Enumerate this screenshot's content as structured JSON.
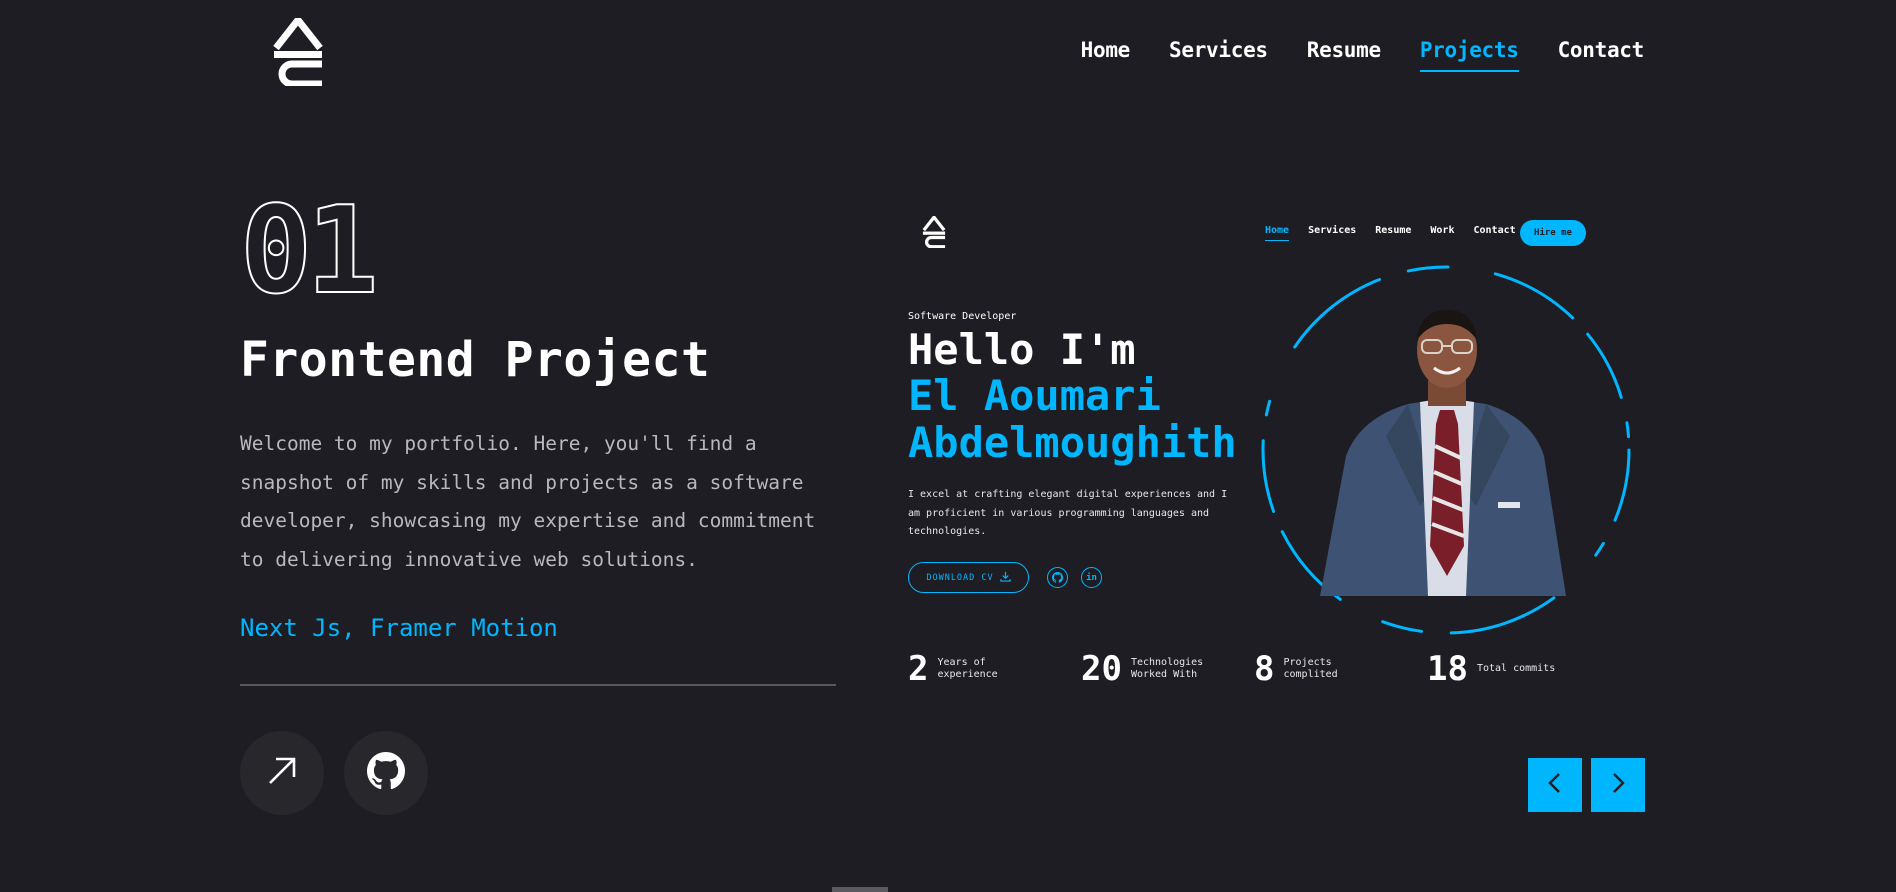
{
  "header": {
    "logo_icon": "ae-logo-icon",
    "nav": [
      {
        "label": "Home",
        "active": false
      },
      {
        "label": "Services",
        "active": false
      },
      {
        "label": "Resume",
        "active": false
      },
      {
        "label": "Projects",
        "active": true
      },
      {
        "label": "Contact",
        "active": false
      }
    ]
  },
  "project": {
    "number": "01",
    "title": "Frontend Project",
    "description": "Welcome to my portfolio. Here, you'll find a snapshot of my skills and projects as a software developer, showcasing my expertise and commitment to delivering innovative web solutions.",
    "stack": "Next Js, Framer Motion",
    "buttons": [
      {
        "icon": "arrow-up-right-icon"
      },
      {
        "icon": "github-icon"
      }
    ]
  },
  "preview": {
    "nav": [
      {
        "label": "Home",
        "active": true
      },
      {
        "label": "Services",
        "active": false
      },
      {
        "label": "Resume",
        "active": false
      },
      {
        "label": "Work",
        "active": false
      },
      {
        "label": "Contact",
        "active": false
      }
    ],
    "hire_label": "Hire me",
    "role": "Software Developer",
    "hello": "Hello I'm",
    "name": "El Aoumari Abdelmoughith",
    "description": "I excel at crafting elegant digital experiences and I am proficient in various programming languages and technologies.",
    "cv_label": "DOWNLOAD CV",
    "socials": [
      {
        "icon": "github-icon"
      },
      {
        "icon": "linkedin-icon",
        "text": "in"
      }
    ],
    "stats": [
      {
        "number": "2",
        "label": "Years of experience"
      },
      {
        "number": "20",
        "label": "Technologies Worked With"
      },
      {
        "number": "8",
        "label": "Projects complited"
      },
      {
        "number": "18",
        "label": "Total commits"
      }
    ]
  },
  "slider": {
    "prev_icon": "chevron-left-icon",
    "next_icon": "chevron-right-icon"
  },
  "colors": {
    "background": "#1e1d23",
    "accent": "#00b7ff",
    "text": "#ffffff",
    "muted": "#b9b9bb"
  }
}
